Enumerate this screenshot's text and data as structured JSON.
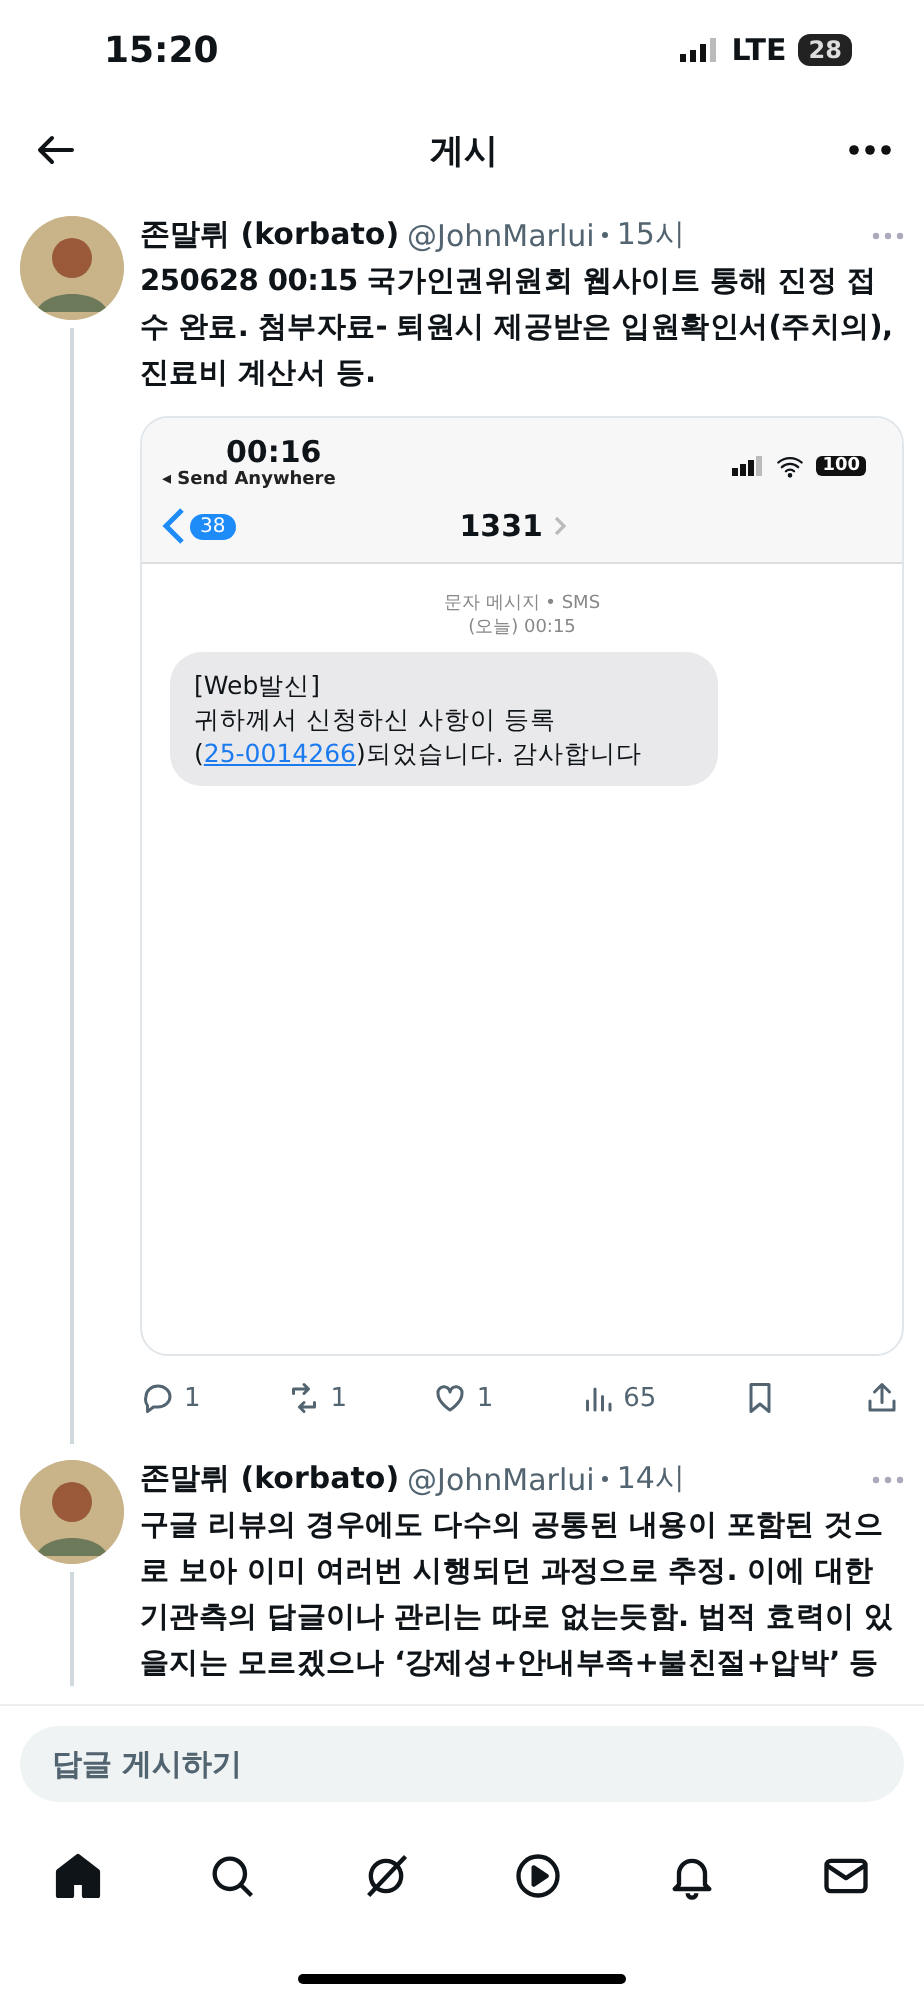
{
  "status_bar": {
    "time": "15:20",
    "network": "LTE",
    "battery": "28"
  },
  "header": {
    "title": "게시"
  },
  "posts": [
    {
      "name": "존말뤼 (korbato)",
      "handle": "@JohnMarlui",
      "time": "15시",
      "text": "250628 00:15 국가인권위원회 웹사이트 통해 진정 접수 완료. 첨부자료- 퇴원시 제공받은 입원확인서(주치의), 진료비 계산서 등.",
      "attachment": {
        "kind": "screenshot",
        "status_time": "00:16",
        "back_app": "◂ Send Anywhere",
        "battery": "100",
        "unread": "38",
        "contact": "1331",
        "service": "문자 메시지 • SMS",
        "timestamp": "(오늘) 00:15",
        "message": {
          "first_line": "[Web발신]",
          "before": "귀하께서 신청하신 사항이 등록(",
          "link": "25-0014266",
          "after": ")되었습니다. 감사합니다"
        }
      },
      "stats": {
        "replies": "1",
        "reposts": "1",
        "likes": "1",
        "views": "65"
      }
    },
    {
      "name": "존말뤼 (korbato)",
      "handle": "@JohnMarlui",
      "time": "14시",
      "text": "구글 리뷰의 경우에도 다수의 공통된 내용이 포함된 것으로 보아 이미 여러번 시행되던 과정으로 추정. 이에 대한 기관측의 답글이나 관리는 따로 없는듯함. 법적 효력이 있을지는 모르겠으나 ‘강제성+안내부족+불친절+압박’ 등"
    }
  ],
  "reply_field": {
    "placeholder": "답글 게시하기"
  },
  "tab_bar": [
    {
      "kind": "home",
      "selected": true
    },
    {
      "kind": "search",
      "selected": false
    },
    {
      "kind": "grok",
      "selected": false
    },
    {
      "kind": "video",
      "selected": false
    },
    {
      "kind": "notifications",
      "selected": false
    },
    {
      "kind": "messages",
      "selected": false
    }
  ]
}
